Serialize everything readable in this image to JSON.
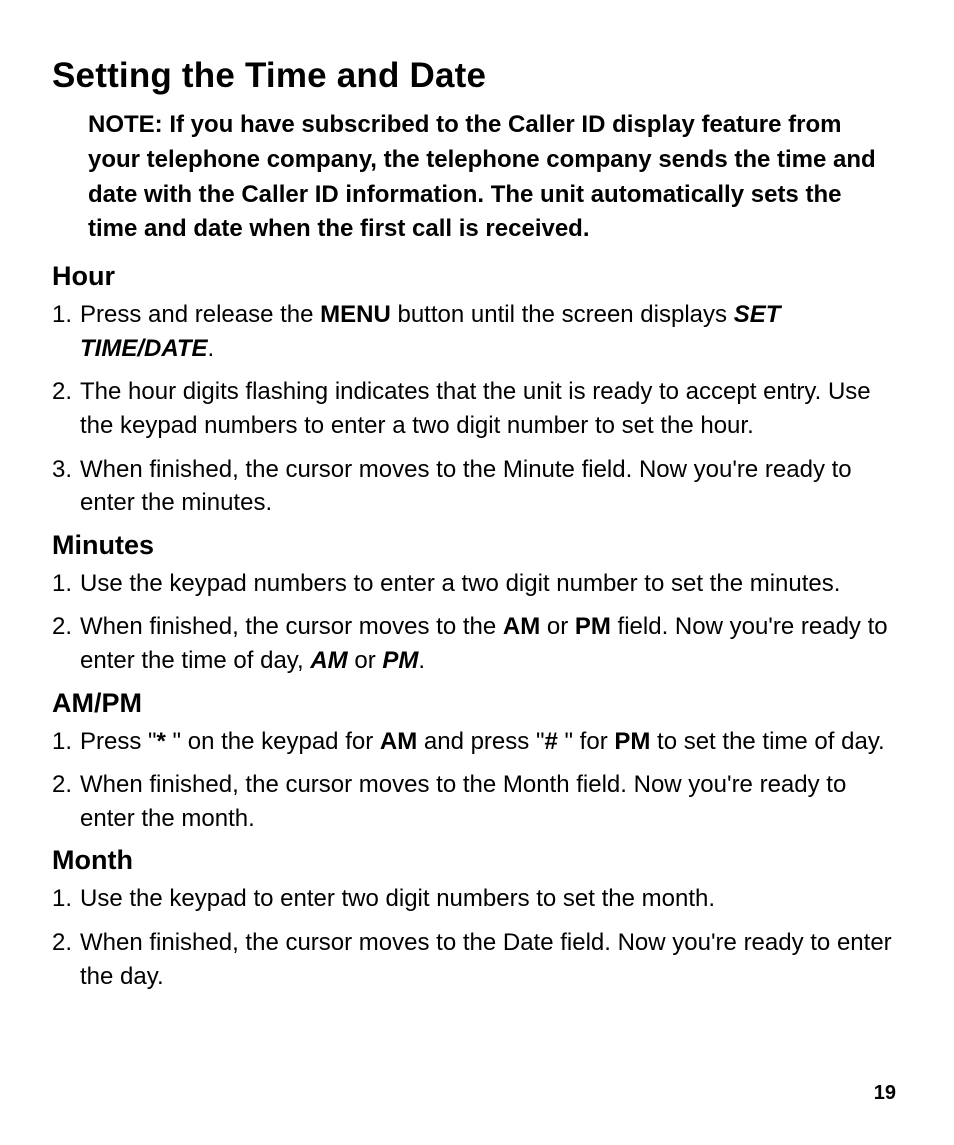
{
  "title": "Setting the Time and Date",
  "note": "NOTE: If you have subscribed to the Caller ID display feature from your telephone company, the telephone company sends the time and date with the Caller ID information. The unit automatically sets the time and date when the first call is received.",
  "hour": {
    "heading": "Hour",
    "s1a": "Press and release the ",
    "s1b": "MENU",
    "s1c": " button until the screen displays ",
    "s1d": "SET TIME/DATE",
    "s1e": ".",
    "s2": "The hour digits flashing indicates that the unit is ready to accept entry. Use the keypad numbers to enter a two digit number to set the hour.",
    "s3": "When finished, the cursor moves to the Minute field. Now you're ready to enter the minutes."
  },
  "minutes": {
    "heading": "Minutes",
    "s1": "Use the keypad numbers to enter a two digit number to set the minutes.",
    "s2a": "When finished, the cursor moves to the ",
    "s2b": "AM",
    "s2c": " or ",
    "s2d": "PM",
    "s2e": " field. Now you're ready to enter the time of day, ",
    "s2f": "AM",
    "s2g": " or ",
    "s2h": "PM",
    "s2i": "."
  },
  "ampm": {
    "heading": "AM/PM",
    "s1a": "Press \"",
    "s1b": "*",
    "s1c": " \" on the keypad for ",
    "s1d": "AM",
    "s1e": " and press \"",
    "s1f": "#",
    "s1g": " \" for ",
    "s1h": "PM",
    "s1i": " to set the time of day.",
    "s2": "When finished, the cursor moves to the Month field. Now you're ready to enter the month."
  },
  "month": {
    "heading": "Month",
    "s1": "Use the keypad to enter two digit numbers to set the month.",
    "s2": "When finished, the cursor moves to the Date field. Now you're ready to enter the day."
  },
  "page": "19",
  "num1": "1.",
  "num2": "2.",
  "num3": "3."
}
